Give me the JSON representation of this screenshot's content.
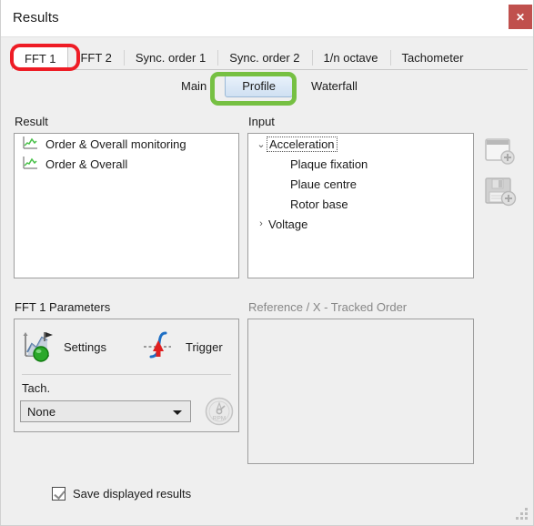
{
  "window": {
    "title": "Results",
    "close_label": "✕"
  },
  "tabs": [
    {
      "label": "FFT 1",
      "active": true
    },
    {
      "label": "FFT 2",
      "active": false
    },
    {
      "label": "Sync. order 1",
      "active": false
    },
    {
      "label": "Sync. order 2",
      "active": false
    },
    {
      "label": "1/n octave",
      "active": false
    },
    {
      "label": "Tachometer",
      "active": false
    }
  ],
  "subtabs": [
    {
      "label": "Main",
      "selected": false
    },
    {
      "label": "Profile",
      "selected": true
    },
    {
      "label": "Waterfall",
      "selected": false
    }
  ],
  "result": {
    "label": "Result",
    "items": [
      {
        "text": "Order & Overall monitoring",
        "icon": "chart-icon"
      },
      {
        "text": "Order & Overall",
        "icon": "chart-icon"
      }
    ]
  },
  "input": {
    "label": "Input",
    "tree": [
      {
        "label": "Acceleration",
        "level": 0,
        "expanded": true,
        "focused": true,
        "arrow": "⌄"
      },
      {
        "label": "Plaque fixation",
        "level": 1,
        "expanded": null,
        "focused": false,
        "arrow": ""
      },
      {
        "label": "Plaue centre",
        "level": 1,
        "expanded": null,
        "focused": false,
        "arrow": ""
      },
      {
        "label": "Rotor base",
        "level": 1,
        "expanded": null,
        "focused": false,
        "arrow": ""
      },
      {
        "label": "Voltage",
        "level": 0,
        "expanded": false,
        "focused": false,
        "arrow": "›"
      }
    ]
  },
  "side_icons": [
    {
      "name": "add-window-icon"
    },
    {
      "name": "save-add-icon"
    }
  ],
  "parameters": {
    "label": "FFT 1  Parameters",
    "settings_label": "Settings",
    "trigger_label": "Trigger",
    "tach_label": "Tach.",
    "tach_value": "None",
    "tach_options": [
      "None"
    ],
    "rpm_icon_text": "RPM"
  },
  "reference": {
    "label": "Reference / X  -  Tracked Order",
    "content": ""
  },
  "footer": {
    "save_displayed_results_label": "Save displayed results",
    "save_displayed_results_checked": true
  },
  "colors": {
    "accent_red": "#c0504d",
    "annotation_red": "#ee1c25",
    "annotation_green": "#76c043",
    "selected_tab_blue": "#cfe0f2",
    "chart_green": "#4ac14a",
    "body_background": "#efefef",
    "titlebar_background": "#ffffff"
  }
}
